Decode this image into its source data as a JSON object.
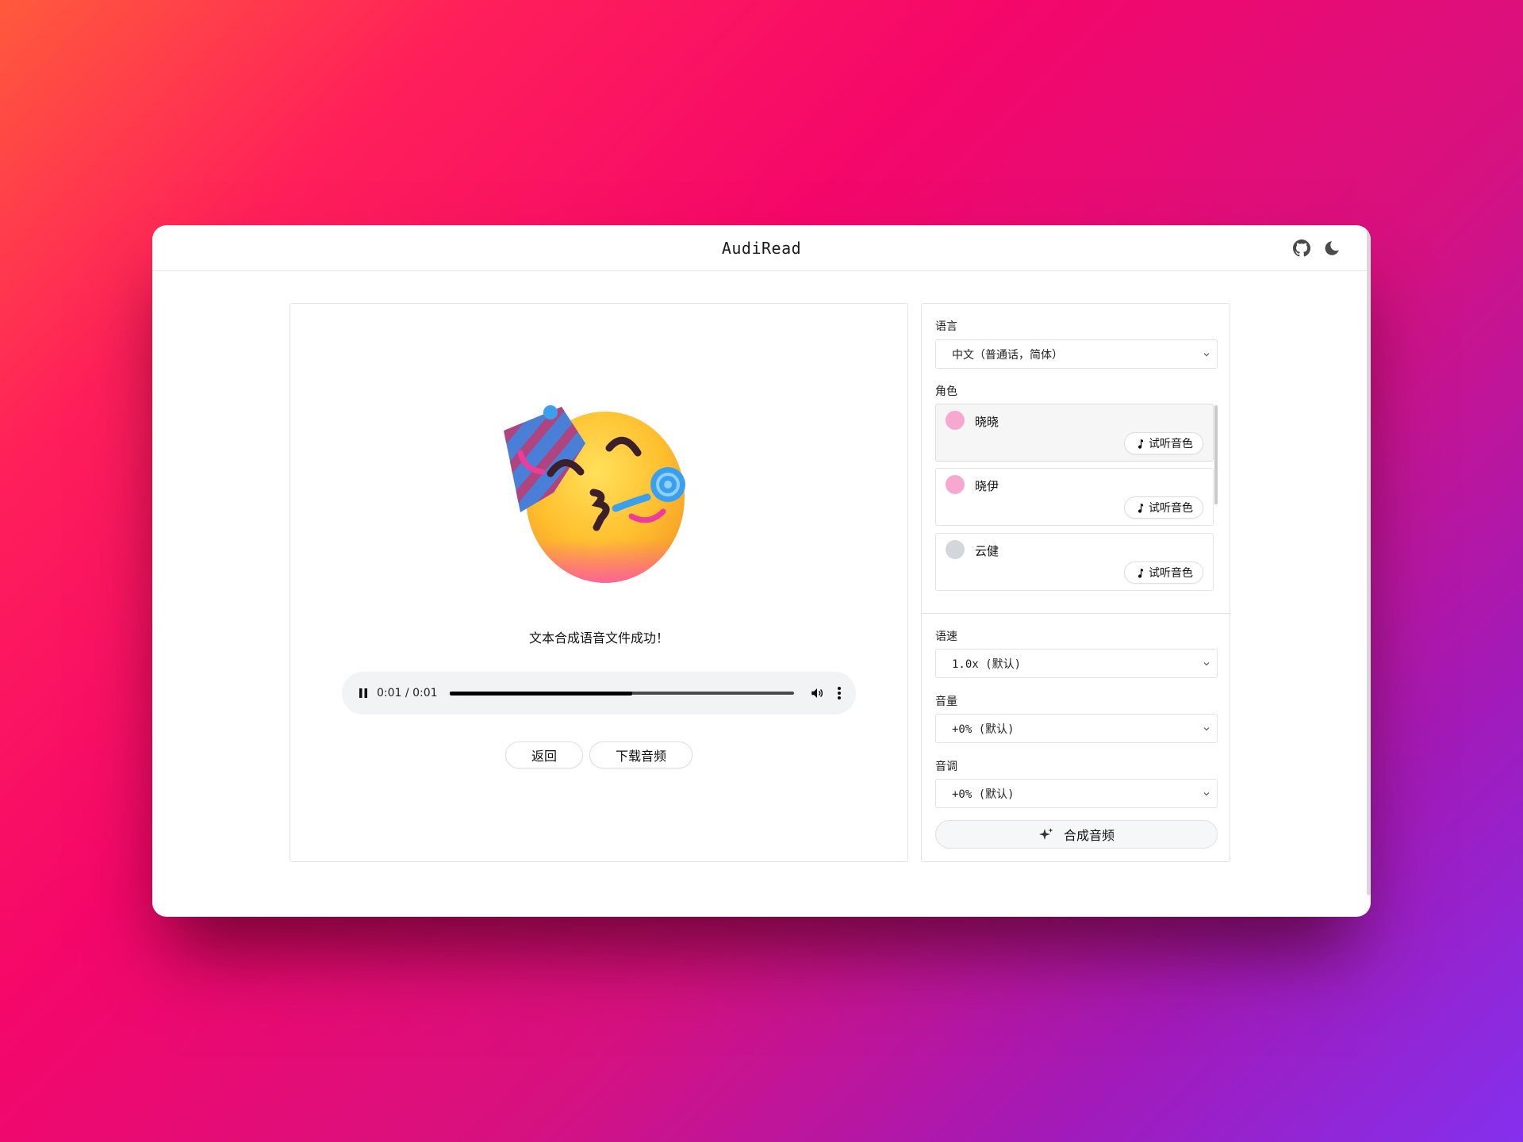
{
  "app": {
    "title": "AudiRead",
    "icons": [
      "github-icon",
      "moon-icon"
    ]
  },
  "result": {
    "message": "文本合成语音文件成功！",
    "emoji": "partying-face-emoji",
    "player": {
      "current_time": "0:01",
      "separator": " / ",
      "duration": "0:01",
      "progress_fraction": 0.53
    },
    "buttons": {
      "back": "返回",
      "download": "下载音频"
    }
  },
  "settings": {
    "language": {
      "label": "语言",
      "value": "中文（普通话，简体）"
    },
    "role": {
      "label": "角色",
      "preview_label": "试听音色",
      "items": [
        {
          "name": "晓晓",
          "color": "#f7a8d0",
          "selected": true
        },
        {
          "name": "晓伊",
          "color": "#f7a8d0",
          "selected": false
        },
        {
          "name": "云健",
          "color": "#d3d6db",
          "selected": false
        }
      ]
    },
    "rate": {
      "label": "语速",
      "value": "1.0x (默认)"
    },
    "volume": {
      "label": "音量",
      "value": "+0% (默认)"
    },
    "pitch": {
      "label": "音调",
      "value": "+0% (默认)"
    },
    "synthesize_label": "合成音频"
  },
  "colors": {
    "panel_border": "#e3e3e3",
    "player_bg": "#f1f3f4",
    "pink_avatar": "#f7a8d0",
    "gray_avatar": "#d3d6db"
  }
}
